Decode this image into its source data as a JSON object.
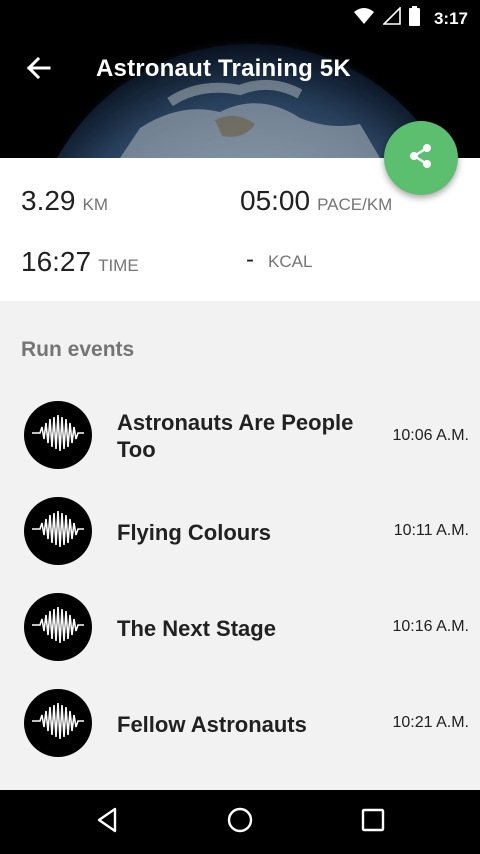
{
  "status_bar": {
    "time": "3:17"
  },
  "header": {
    "title": "Astronaut Training 5K"
  },
  "stats": {
    "distance": {
      "value": "3.29",
      "unit": "KM"
    },
    "pace": {
      "value": "05:00",
      "unit": "PACE/KM"
    },
    "time": {
      "value": "16:27",
      "unit": "TIME"
    },
    "calories": {
      "value": "-",
      "unit": "KCAL"
    }
  },
  "run_events": {
    "title": "Run events",
    "items": [
      {
        "name": "Astronauts Are People Too",
        "time": "10:06 A.M."
      },
      {
        "name": "Flying Colours",
        "time": "10:11 A.M."
      },
      {
        "name": "The Next Stage",
        "time": "10:16 A.M."
      },
      {
        "name": "Fellow Astronauts",
        "time": "10:21 A.M."
      }
    ]
  },
  "colors": {
    "fab": "#5cbf70",
    "header_bg": "#000000",
    "accent_text": "#757575"
  },
  "icons": {
    "status": [
      "wifi-icon",
      "signal-icon",
      "battery-icon"
    ],
    "back": "arrow-back-icon",
    "share": "share-icon",
    "event_avatar": "waveform-icon",
    "nav": [
      "back-triangle-icon",
      "home-circle-icon",
      "recents-square-icon"
    ]
  }
}
